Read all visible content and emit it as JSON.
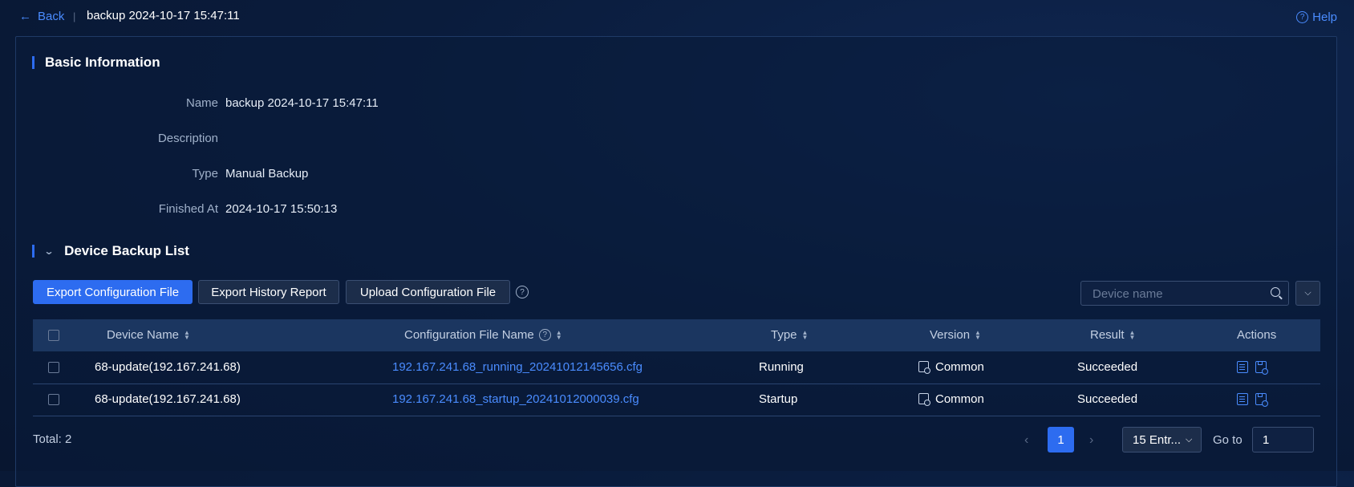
{
  "header": {
    "back_label": "Back",
    "separator": "|",
    "title": "backup 2024-10-17 15:47:11",
    "help_label": "Help"
  },
  "basic_info": {
    "title": "Basic Information",
    "rows": [
      {
        "label": "Name",
        "value": "backup 2024-10-17 15:47:11"
      },
      {
        "label": "Description",
        "value": ""
      },
      {
        "label": "Type",
        "value": "Manual Backup"
      },
      {
        "label": "Finished At",
        "value": "2024-10-17 15:50:13"
      }
    ]
  },
  "device_list": {
    "title": "Device Backup List",
    "buttons": {
      "export_config": "Export Configuration File",
      "export_history": "Export History Report",
      "upload_config": "Upload Configuration File"
    },
    "search": {
      "placeholder": "Device name",
      "value": ""
    },
    "columns": [
      "Device Name",
      "Configuration File Name",
      "Type",
      "Version",
      "Result",
      "Actions"
    ],
    "rows": [
      {
        "device_name": "68-update(192.167.241.68)",
        "file_name": "192.167.241.68_running_20241012145656.cfg",
        "type": "Running",
        "version": "Common",
        "result": "Succeeded"
      },
      {
        "device_name": "68-update(192.167.241.68)",
        "file_name": "192.167.241.68_startup_20241012000039.cfg",
        "type": "Startup",
        "version": "Common",
        "result": "Succeeded"
      }
    ]
  },
  "pagination": {
    "total_label": "Total: 2",
    "current_page": "1",
    "page_size": "15 Entr...",
    "goto_label": "Go to",
    "goto_value": "1"
  },
  "colors": {
    "accent": "#2d6cf0",
    "link": "#4a8cff",
    "background": "#0a1c3c"
  }
}
